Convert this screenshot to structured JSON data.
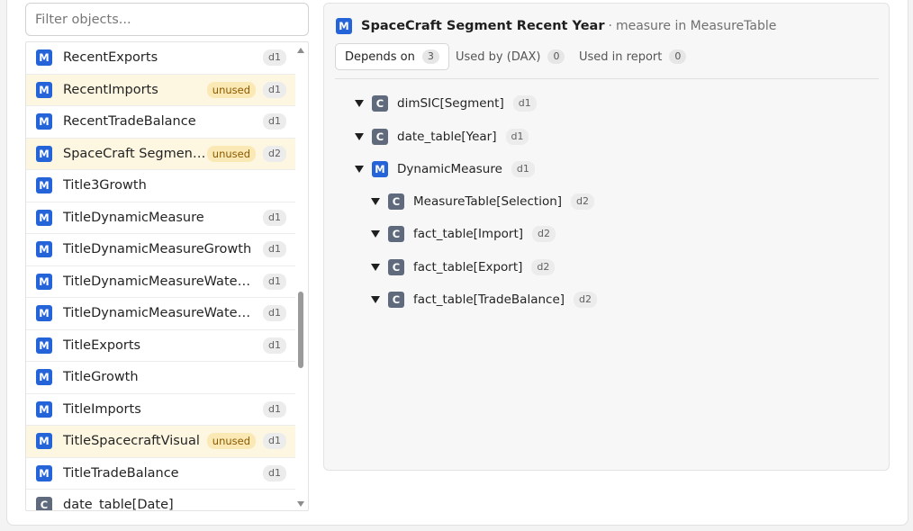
{
  "filter": {
    "placeholder": "Filter objects..."
  },
  "list": {
    "rows": [
      {
        "icon": "M",
        "name": "RecentExports",
        "unused": "",
        "depth": "d1"
      },
      {
        "icon": "M",
        "name": "RecentImports",
        "unused": "unused",
        "depth": "d1"
      },
      {
        "icon": "M",
        "name": "RecentTradeBalance",
        "unused": "",
        "depth": "d1"
      },
      {
        "icon": "M",
        "name": "SpaceCraft Segment ...",
        "unused": "unused",
        "depth": "d2"
      },
      {
        "icon": "M",
        "name": "Title3Growth",
        "unused": "",
        "depth": ""
      },
      {
        "icon": "M",
        "name": "TitleDynamicMeasure",
        "unused": "",
        "depth": "d1"
      },
      {
        "icon": "M",
        "name": "TitleDynamicMeasureGrowth",
        "unused": "",
        "depth": "d1"
      },
      {
        "icon": "M",
        "name": "TitleDynamicMeasureWaterfall",
        "unused": "",
        "depth": "d1"
      },
      {
        "icon": "M",
        "name": "TitleDynamicMeasureWaterfall...",
        "unused": "",
        "depth": "d1"
      },
      {
        "icon": "M",
        "name": "TitleExports",
        "unused": "",
        "depth": "d1"
      },
      {
        "icon": "M",
        "name": "TitleGrowth",
        "unused": "",
        "depth": ""
      },
      {
        "icon": "M",
        "name": "TitleImports",
        "unused": "",
        "depth": "d1"
      },
      {
        "icon": "M",
        "name": "TitleSpacecraftVisual",
        "unused": "unused",
        "depth": "d1"
      },
      {
        "icon": "M",
        "name": "TitleTradeBalance",
        "unused": "",
        "depth": "d1"
      },
      {
        "icon": "C",
        "name": "date_table[Date]",
        "unused": "",
        "depth": ""
      }
    ]
  },
  "detail": {
    "icon": "M",
    "title": "SpaceCraft Segment Recent Year",
    "separator": "·",
    "subtitle": "measure in MeasureTable",
    "tabs": [
      {
        "label": "Depends on",
        "count": "3"
      },
      {
        "label": "Used by (DAX)",
        "count": "0"
      },
      {
        "label": "Used in report",
        "count": "0"
      }
    ],
    "tree": [
      {
        "icon": "C",
        "label": "dimSIC[Segment]",
        "depth": "d1"
      },
      {
        "icon": "C",
        "label": "date_table[Year]",
        "depth": "d1"
      },
      {
        "icon": "M",
        "label": "DynamicMeasure",
        "depth": "d1"
      },
      {
        "icon": "C",
        "label": "MeasureTable[Selection]",
        "depth": "d2"
      },
      {
        "icon": "C",
        "label": "fact_table[Import]",
        "depth": "d2"
      },
      {
        "icon": "C",
        "label": "fact_table[Export]",
        "depth": "d2"
      },
      {
        "icon": "C",
        "label": "fact_table[TradeBalance]",
        "depth": "d2"
      }
    ]
  },
  "colors": {
    "measure_icon": "#2563d9",
    "column_icon": "#5f6b7d",
    "unused_row_bg": "#fdf7e1",
    "unused_tag_bg": "#fbe9b5"
  }
}
